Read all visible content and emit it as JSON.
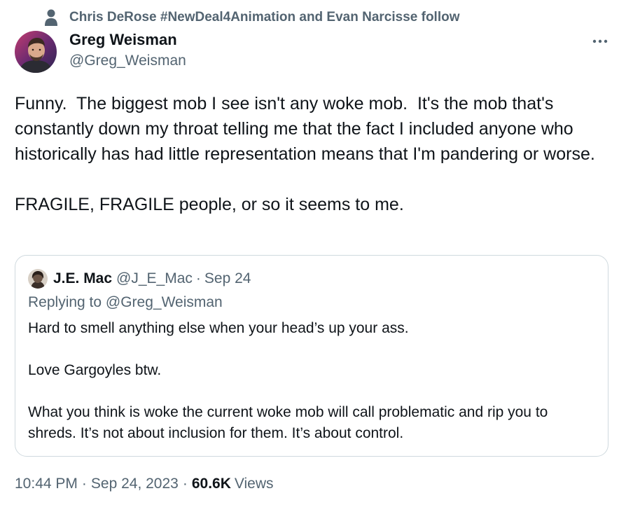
{
  "social_context": {
    "icon": "person-icon",
    "text": "Chris DeRose #NewDeal4Animation and Evan Narcisse follow"
  },
  "tweet": {
    "author_name": "Greg Weisman",
    "author_handle": "@Greg_Weisman",
    "text": "Funny.  The biggest mob I see isn't any woke mob.  It's the mob that's constantly down my throat telling me that the fact I included anyone who historically has had little representation means that I'm pandering or worse.\n\nFRAGILE, FRAGILE people, or so it seems to me.",
    "more_icon": "more-horizontal-icon"
  },
  "quoted_tweet": {
    "author_name": "J.E. Mac",
    "author_handle": "@J_E_Mac",
    "separator": "·",
    "date": "Sep 24",
    "replying_to": "Replying to @Greg_Weisman",
    "text": "Hard to smell anything else when your head’s up your ass.\n\nLove Gargoyles btw.\n\nWhat you think is woke the current woke mob will call problematic and rip you to shreds. It’s not about inclusion for them. It’s about control."
  },
  "meta": {
    "time": "10:44 PM",
    "separator": "·",
    "date": "Sep 24, 2023",
    "views_count": "60.6K",
    "views_label": "Views"
  },
  "colors": {
    "text_primary": "#0f1419",
    "text_secondary": "#536471",
    "border": "#cfd9de",
    "background": "#ffffff"
  }
}
